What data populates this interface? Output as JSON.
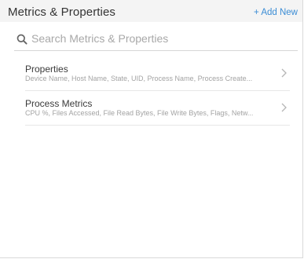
{
  "header": {
    "title": "Metrics & Properties",
    "add_new_label": "+ Add New"
  },
  "search": {
    "placeholder": "Search Metrics & Properties",
    "value": ""
  },
  "items": [
    {
      "name": "Properties",
      "description": "Device Name, Host Name, State, UID, Process Name, Process Create..."
    },
    {
      "name": "Process Metrics",
      "description": "CPU %, Files Accessed, File Read Bytes, File Write Bytes, Flags, Netw..."
    }
  ],
  "colors": {
    "accent": "#3b8dd5",
    "header_bg": "#f4f4f4",
    "text_muted": "#a3a3a3"
  }
}
